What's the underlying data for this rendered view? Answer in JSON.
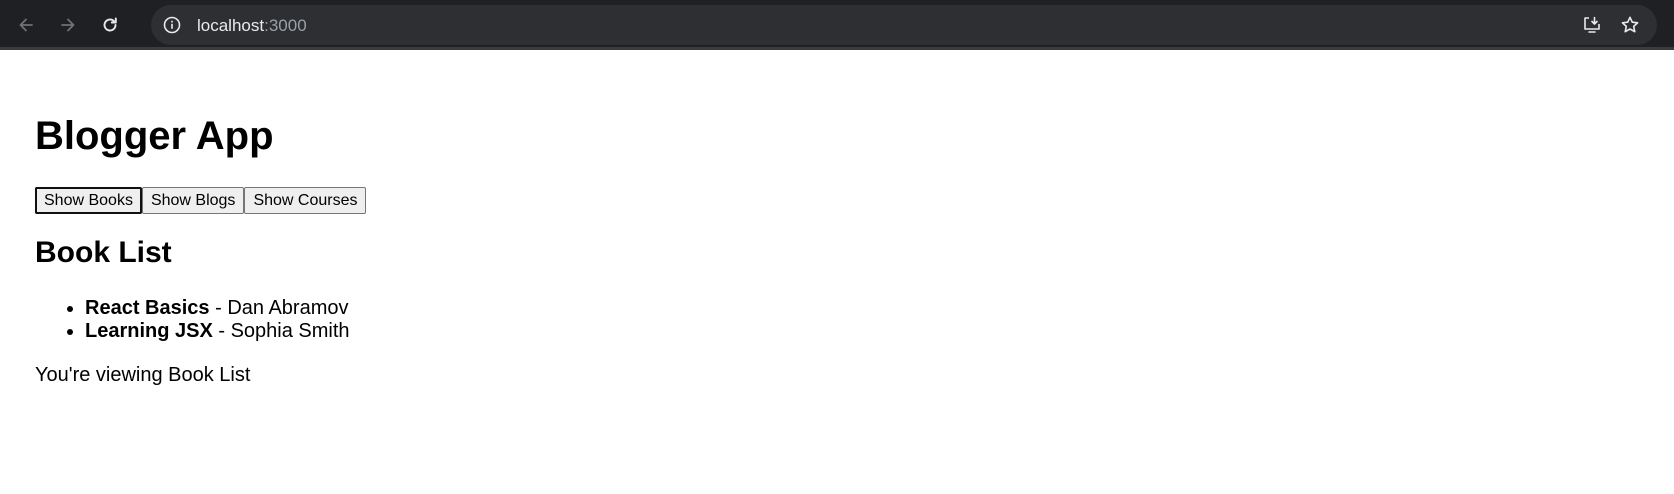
{
  "browser": {
    "url_host": "localhost",
    "url_port": ":3000",
    "icons": {
      "back": "arrow-left-icon",
      "forward": "arrow-right-icon",
      "reload": "reload-icon",
      "info": "info-icon",
      "install": "install-app-icon",
      "bookmark": "star-icon"
    }
  },
  "app": {
    "title": "Blogger App",
    "buttons": [
      {
        "label": "Show Books",
        "active": true
      },
      {
        "label": "Show Blogs",
        "active": false
      },
      {
        "label": "Show Courses",
        "active": false
      }
    ],
    "section_title": "Book List",
    "books": [
      {
        "title": "React Basics",
        "separator": " - ",
        "author": "Dan Abramov"
      },
      {
        "title": "Learning JSX",
        "separator": " - ",
        "author": "Sophia Smith"
      }
    ],
    "status": "You're viewing Book List"
  }
}
